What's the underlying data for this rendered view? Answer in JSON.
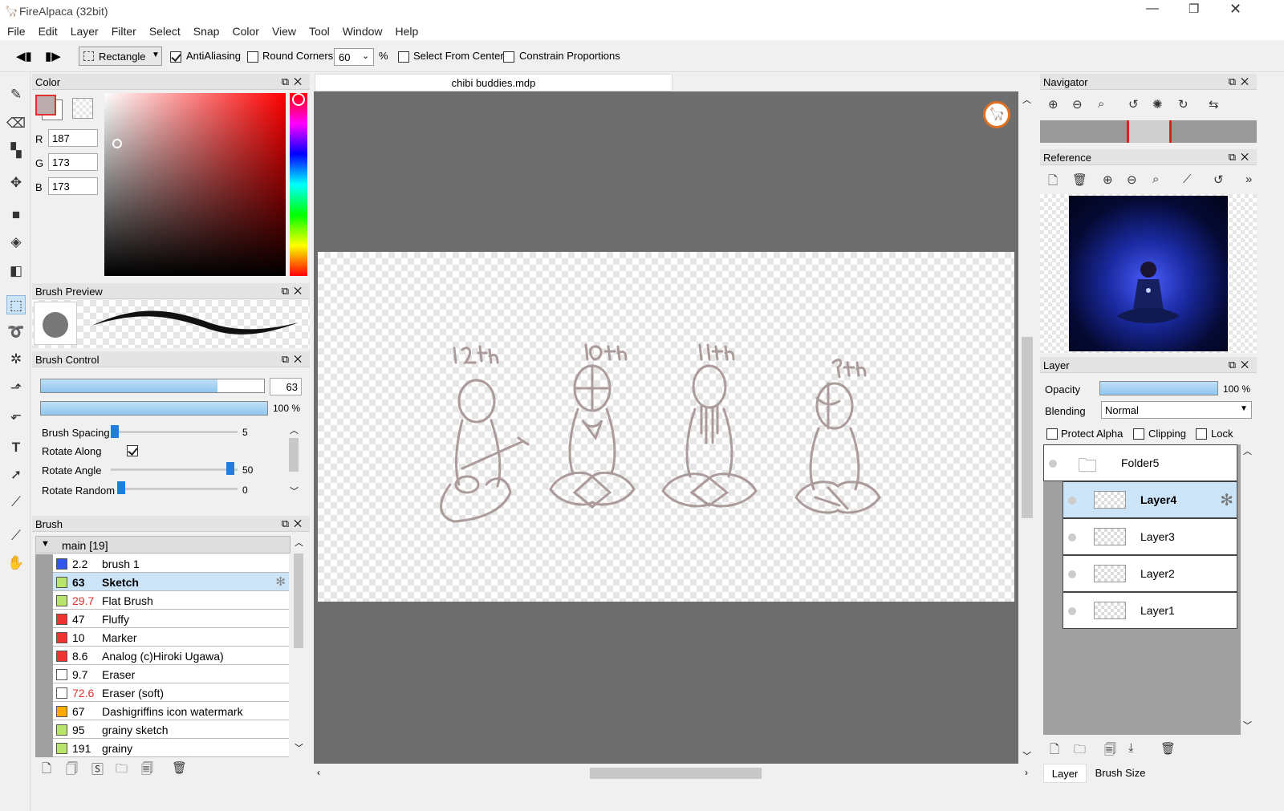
{
  "window": {
    "title": "FireAlpaca (32bit)"
  },
  "menu": [
    "File",
    "Edit",
    "Layer",
    "Filter",
    "Select",
    "Snap",
    "Color",
    "View",
    "Tool",
    "Window",
    "Help"
  ],
  "toolbar": {
    "shape": "Rectangle",
    "antialiasing": "AntiAliasing",
    "round_corners": "Round Corners",
    "corner_value": "60",
    "percent": "%",
    "select_from_center": "Select From Center",
    "constrain": "Constrain Proportions"
  },
  "color_panel": {
    "title": "Color",
    "r_label": "R",
    "g_label": "G",
    "b_label": "B",
    "r": "187",
    "g": "173",
    "b": "173",
    "current_color": "#bbadad"
  },
  "brush_preview": {
    "title": "Brush Preview"
  },
  "brush_control": {
    "title": "Brush Control",
    "size": "63",
    "size_fraction": 0.79,
    "opacity": "100 %",
    "spacing_label": "Brush Spacing",
    "spacing_value": "5",
    "rotate_along_label": "Rotate Along",
    "rotate_angle_label": "Rotate Angle",
    "rotate_angle_value": "50",
    "rotate_random_label": "Rotate Random",
    "rotate_random_value": "0"
  },
  "brush_panel": {
    "title": "Brush",
    "group": "main [19]",
    "items": [
      {
        "size": "2.2",
        "name": "brush 1",
        "color": "#3355ee",
        "red": false,
        "selected": false
      },
      {
        "size": "63",
        "name": "Sketch",
        "color": "#b9e66a",
        "red": false,
        "selected": true
      },
      {
        "size": "29.7",
        "name": "Flat Brush",
        "color": "#b9e66a",
        "red": true,
        "selected": false
      },
      {
        "size": "47",
        "name": "Fluffy",
        "color": "#ee3333",
        "red": false,
        "selected": false
      },
      {
        "size": "10",
        "name": "Marker",
        "color": "#ee3333",
        "red": false,
        "selected": false
      },
      {
        "size": "8.6",
        "name": "Analog (c)Hiroki Ugawa)",
        "color": "#ee3333",
        "red": false,
        "selected": false
      },
      {
        "size": "9.7",
        "name": "Eraser",
        "color": "#ffffff",
        "red": false,
        "selected": false
      },
      {
        "size": "72.6",
        "name": "Eraser (soft)",
        "color": "#ffffff",
        "red": true,
        "selected": false
      },
      {
        "size": "67",
        "name": "Dashigriffins icon watermark",
        "color": "#ffaa00",
        "red": false,
        "selected": false
      },
      {
        "size": "95",
        "name": "grainy sketch",
        "color": "#b9e66a",
        "red": false,
        "selected": false
      },
      {
        "size": "191",
        "name": "grainy",
        "color": "#b9e66a",
        "red": false,
        "selected": false
      }
    ]
  },
  "canvas": {
    "tab": "chibi buddies.mdp",
    "labels": [
      "12th",
      "10th",
      "11th",
      "9th"
    ]
  },
  "navigator": {
    "title": "Navigator"
  },
  "reference": {
    "title": "Reference"
  },
  "layer_panel": {
    "title": "Layer",
    "opacity_label": "Opacity",
    "opacity_value": "100 %",
    "blending_label": "Blending",
    "blending_value": "Normal",
    "protect_alpha": "Protect Alpha",
    "clipping": "Clipping",
    "lock": "Lock",
    "folder": "Folder5",
    "layers": [
      "Layer4",
      "Layer3",
      "Layer2",
      "Layer1"
    ]
  },
  "bottom_tabs": [
    "Layer",
    "Brush Size"
  ]
}
